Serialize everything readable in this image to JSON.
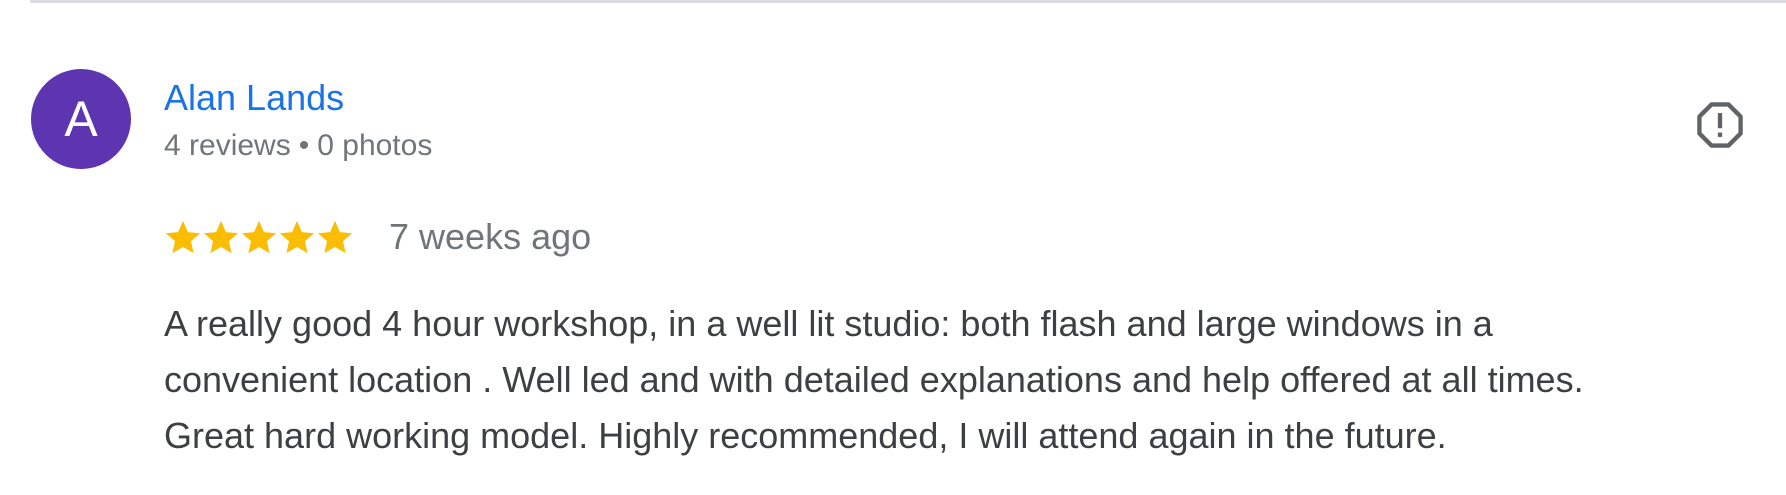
{
  "review": {
    "author": {
      "initial": "A",
      "name": "Alan Lands",
      "reviews": "4 reviews",
      "separator": "•",
      "photos": "0 photos"
    },
    "report_icon": "flag-icon",
    "rating": {
      "stars": 5,
      "max_stars": 5,
      "star_color": "#fbbc04",
      "star_icon": "star-icon"
    },
    "date": "7 weeks ago",
    "text_lines": [
      "A really good 4 hour workshop, in a well lit studio: both flash and large windows in a",
      "convenient location . Well led and with detailed explanations and help offered at all times.",
      "Great hard working model. Highly recommended, I will attend again in the future."
    ]
  },
  "colors": {
    "avatar_bg": "#5e35b1",
    "author_link": "#1a73e8",
    "meta_text": "#70757a",
    "body_text": "#3c4043",
    "divider": "#dadce0",
    "report_icon": "#5f6368"
  }
}
